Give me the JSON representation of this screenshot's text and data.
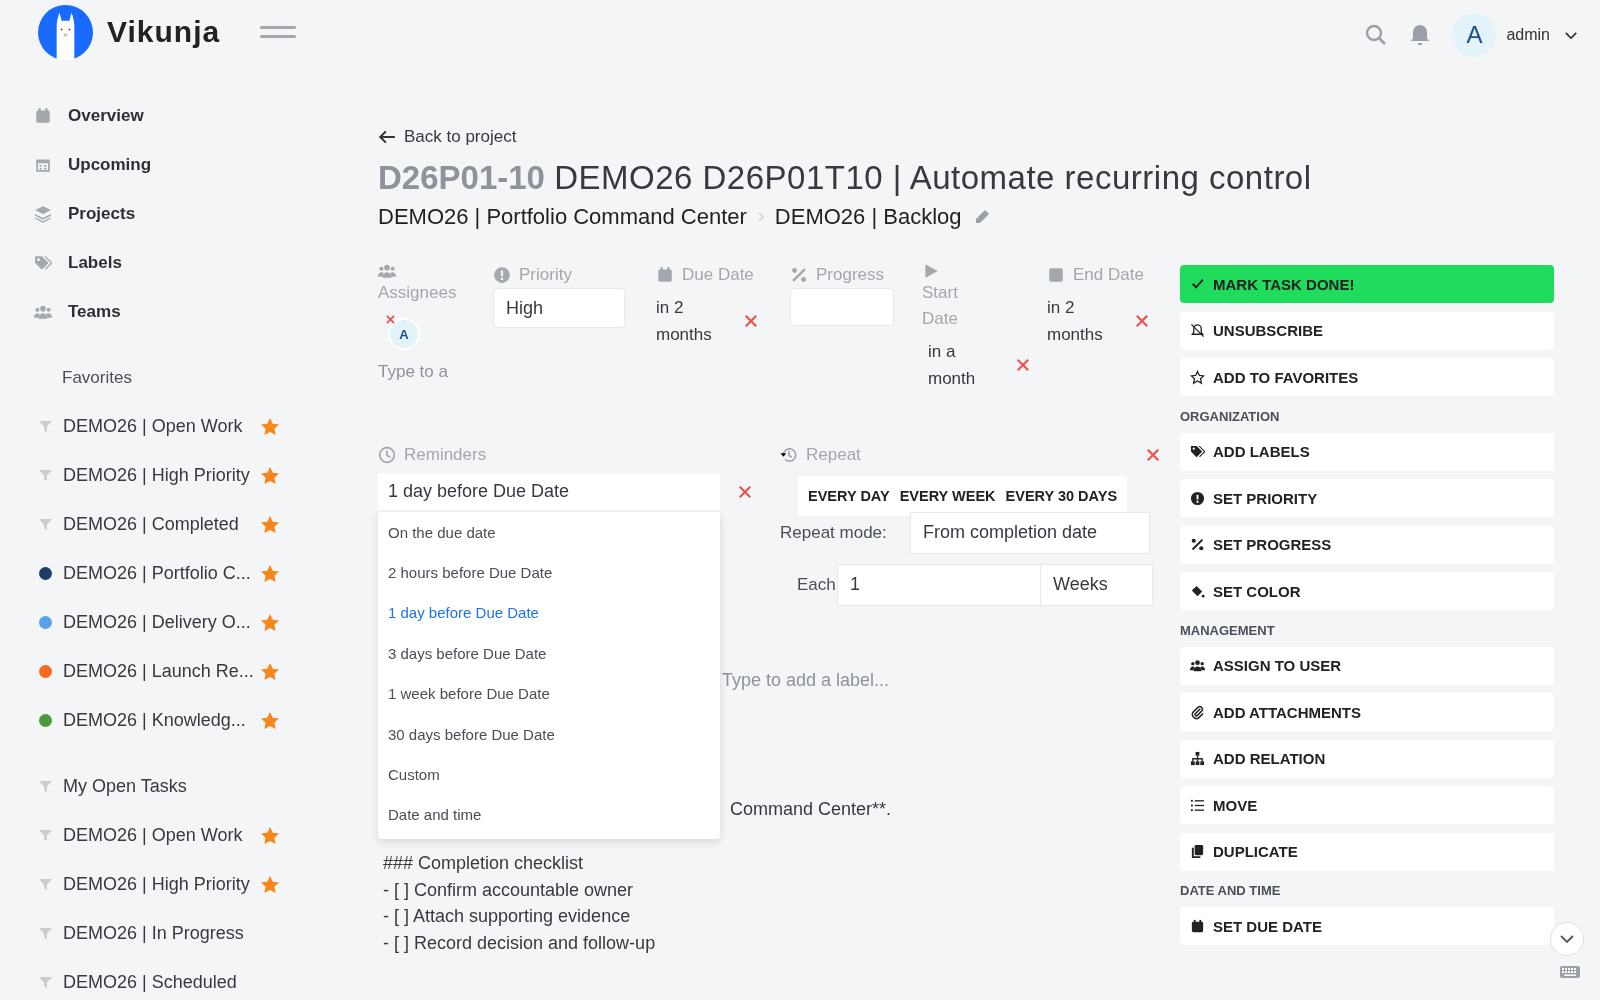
{
  "app": {
    "name": "Vikunja"
  },
  "user": {
    "initial": "A",
    "name": "admin"
  },
  "sidebar": {
    "nav": [
      {
        "label": "Overview",
        "selected": false
      },
      {
        "label": "Upcoming",
        "selected": false
      },
      {
        "label": "Projects",
        "selected": false
      },
      {
        "label": "Labels",
        "selected": false
      },
      {
        "label": "Teams",
        "selected": false
      }
    ],
    "groups": [
      {
        "title": "Favorites",
        "items": [
          {
            "name": "DEMO26 | Open Work",
            "kind": "filter",
            "favorite": true
          },
          {
            "name": "DEMO26 | High Priority",
            "kind": "filter",
            "favorite": true
          },
          {
            "name": "DEMO26 | Completed",
            "kind": "filter",
            "favorite": true
          },
          {
            "name": "DEMO26 | Portfolio C...",
            "kind": "project",
            "color": "#1d3f66",
            "favorite": true
          },
          {
            "name": "DEMO26 | Delivery O...",
            "kind": "project",
            "color": "#5aa0e6",
            "favorite": true
          },
          {
            "name": "DEMO26 | Launch Re...",
            "kind": "project",
            "color": "#f26b21",
            "favorite": true
          },
          {
            "name": "DEMO26 | Knowledg...",
            "kind": "project",
            "color": "#4c9a3c",
            "favorite": true
          }
        ]
      },
      {
        "items": [
          {
            "name": "My Open Tasks",
            "kind": "filter",
            "favorite": false
          },
          {
            "name": "DEMO26 | Open Work",
            "kind": "filter",
            "favorite": true
          },
          {
            "name": "DEMO26 | High Priority",
            "kind": "filter",
            "favorite": true
          },
          {
            "name": "DEMO26 | In Progress",
            "kind": "filter",
            "favorite": false
          },
          {
            "name": "DEMO26 | Scheduled",
            "kind": "filter",
            "favorite": false
          }
        ]
      }
    ]
  },
  "task": {
    "back": "Back to project",
    "identifier": "D26P01-10",
    "title": "DEMO26 D26P01T10 | Automate recurring control",
    "breadcrumb": [
      "DEMO26 | Portfolio Command Center",
      "DEMO26 | Backlog"
    ]
  },
  "fields": [
    {
      "label": "Assignees",
      "kind": "assignees",
      "assignees": [
        {
          "initial": "A"
        }
      ],
      "placeholder": "Type to a"
    },
    {
      "label": "Priority",
      "kind": "select",
      "value": "High"
    },
    {
      "label": "Due Date",
      "kind": "date",
      "value": "in 2 months"
    },
    {
      "label": "Progress",
      "kind": "select"
    },
    {
      "label": "Start Date",
      "kind": "date",
      "value": "in a month"
    },
    {
      "label": "End Date",
      "kind": "date",
      "value": "in 2 months"
    }
  ],
  "reminders": {
    "label": "Reminders",
    "value": "1 day before Due Date",
    "options": [
      {
        "label": "On the due date",
        "selected": false
      },
      {
        "label": "2 hours before Due Date",
        "selected": false
      },
      {
        "label": "1 day before Due Date",
        "selected": true
      },
      {
        "label": "3 days before Due Date",
        "selected": false
      },
      {
        "label": "1 week before Due Date",
        "selected": false
      },
      {
        "label": "30 days before Due Date",
        "selected": false
      },
      {
        "label": "Custom",
        "selected": false
      },
      {
        "label": "Date and time",
        "selected": false
      }
    ]
  },
  "repeat": {
    "label": "Repeat",
    "presets": [
      "EVERY DAY",
      "EVERY WEEK",
      "EVERY 30 DAYS"
    ],
    "mode_label": "Repeat mode:",
    "mode": "From completion date",
    "each_label": "Each",
    "amount": "1",
    "unit": "Weeks"
  },
  "labels": {
    "placeholder": "Type to add a label..."
  },
  "description": {
    "visible_tail": "Command Center**.",
    "lines": [
      "### Completion checklist",
      "- [ ] Confirm accountable owner",
      "- [ ] Attach supporting evidence",
      "- [ ] Record decision and follow-up"
    ]
  },
  "actions": {
    "primary": [
      {
        "label": "MARK TASK DONE!",
        "kind": "success"
      },
      {
        "label": "UNSUBSCRIBE",
        "kind": "default"
      },
      {
        "label": "ADD TO FAVORITES",
        "kind": "default"
      }
    ],
    "groups": [
      {
        "title": "ORGANIZATION",
        "items": [
          "ADD LABELS",
          "SET PRIORITY",
          "SET PROGRESS",
          "SET COLOR"
        ]
      },
      {
        "title": "MANAGEMENT",
        "items": [
          "ASSIGN TO USER",
          "ADD ATTACHMENTS",
          "ADD RELATION",
          "MOVE",
          "DUPLICATE"
        ]
      },
      {
        "title": "DATE AND TIME",
        "items": [
          "SET DUE DATE"
        ]
      }
    ]
  }
}
